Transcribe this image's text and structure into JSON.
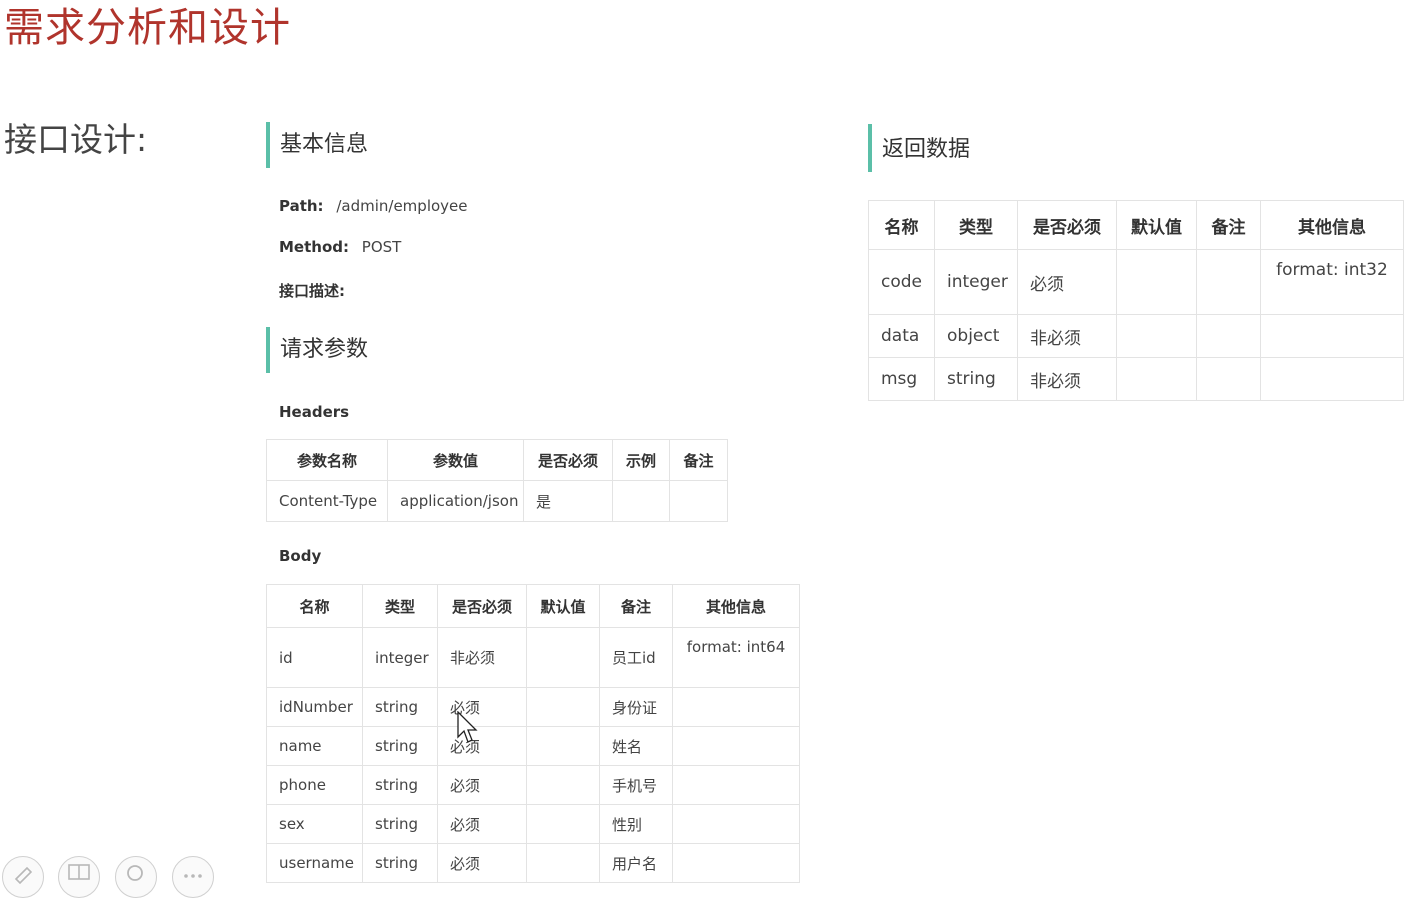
{
  "title": "需求分析和设计",
  "side_heading": "接口设计:",
  "basic": {
    "heading": "基本信息",
    "path_label": "Path:",
    "path_value": "/admin/employee",
    "method_label": "Method:",
    "method_value": "POST",
    "desc_label": "接口描述:"
  },
  "request": {
    "heading": "请求参数",
    "headers_label": "Headers",
    "headers_columns": [
      "参数名称",
      "参数值",
      "是否必须",
      "示例",
      "备注"
    ],
    "headers_rows": [
      [
        "Content-Type",
        "application/json",
        "是",
        "",
        ""
      ]
    ],
    "body_label": "Body",
    "body_columns": [
      "名称",
      "类型",
      "是否必须",
      "默认值",
      "备注",
      "其他信息"
    ],
    "body_rows": [
      [
        "id",
        "integer",
        "非必须",
        "",
        "员工id",
        "format: int64"
      ],
      [
        "idNumber",
        "string",
        "必须",
        "",
        "身份证",
        ""
      ],
      [
        "name",
        "string",
        "必须",
        "",
        "姓名",
        ""
      ],
      [
        "phone",
        "string",
        "必须",
        "",
        "手机号",
        ""
      ],
      [
        "sex",
        "string",
        "必须",
        "",
        "性别",
        ""
      ],
      [
        "username",
        "string",
        "必须",
        "",
        "用户名",
        ""
      ]
    ]
  },
  "response": {
    "heading": "返回数据",
    "columns": [
      "名称",
      "类型",
      "是否必须",
      "默认值",
      "备注",
      "其他信息"
    ],
    "rows": [
      [
        "code",
        "integer",
        "必须",
        "",
        "",
        "format: int32"
      ],
      [
        "data",
        "object",
        "非必须",
        "",
        "",
        ""
      ],
      [
        "msg",
        "string",
        "非必须",
        "",
        "",
        ""
      ]
    ]
  },
  "toolbar_icons": [
    "pen-icon",
    "layout-icon",
    "zoom-icon",
    "more-icon"
  ],
  "colors": {
    "title": "#b0342c",
    "accent_bar": "#5bbfa8",
    "grid": "#e3e3e3"
  }
}
